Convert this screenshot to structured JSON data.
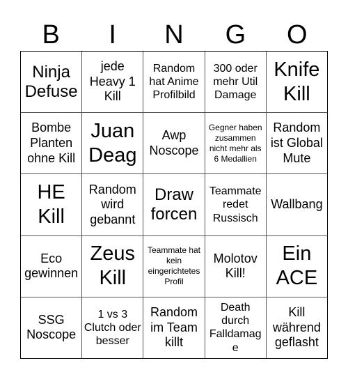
{
  "card": {
    "header": [
      "B",
      "I",
      "N",
      "G",
      "O"
    ],
    "cells": [
      {
        "text": "Ninja Defuse",
        "size": "lg"
      },
      {
        "text": "jede Heavy 1 Kill",
        "size": "md"
      },
      {
        "text": "Random hat Anime Profilbild",
        "size": "sm"
      },
      {
        "text": "300 oder mehr Util Damage",
        "size": "sm"
      },
      {
        "text": "Knife Kill",
        "size": "xl"
      },
      {
        "text": "Bombe Planten ohne Kill",
        "size": "md"
      },
      {
        "text": "Juan Deag",
        "size": "xl"
      },
      {
        "text": "Awp Noscope",
        "size": "md"
      },
      {
        "text": "Gegner haben zusammen nicht mehr als 6 Medallien",
        "size": "xs"
      },
      {
        "text": "Random ist Global Mute",
        "size": "md"
      },
      {
        "text": "HE Kill",
        "size": "xl"
      },
      {
        "text": "Random wird gebannt",
        "size": "md"
      },
      {
        "text": "Draw forcen",
        "size": "lg"
      },
      {
        "text": "Teammate redet Russisch",
        "size": "sm"
      },
      {
        "text": "Wallbang",
        "size": "md"
      },
      {
        "text": "Eco gewinnen",
        "size": "md"
      },
      {
        "text": "Zeus Kill",
        "size": "xl"
      },
      {
        "text": "Teammate hat kein eingerichtetes Profil",
        "size": "xs"
      },
      {
        "text": "Molotov Kill!",
        "size": "md"
      },
      {
        "text": "Ein ACE",
        "size": "xl"
      },
      {
        "text": "SSG Noscope",
        "size": "md"
      },
      {
        "text": "1 vs 3 Clutch oder besser",
        "size": "sm"
      },
      {
        "text": "Random im Team killt",
        "size": "md"
      },
      {
        "text": "Death durch Falldamage",
        "size": "sm"
      },
      {
        "text": "Kill während geflasht",
        "size": "md"
      }
    ]
  }
}
